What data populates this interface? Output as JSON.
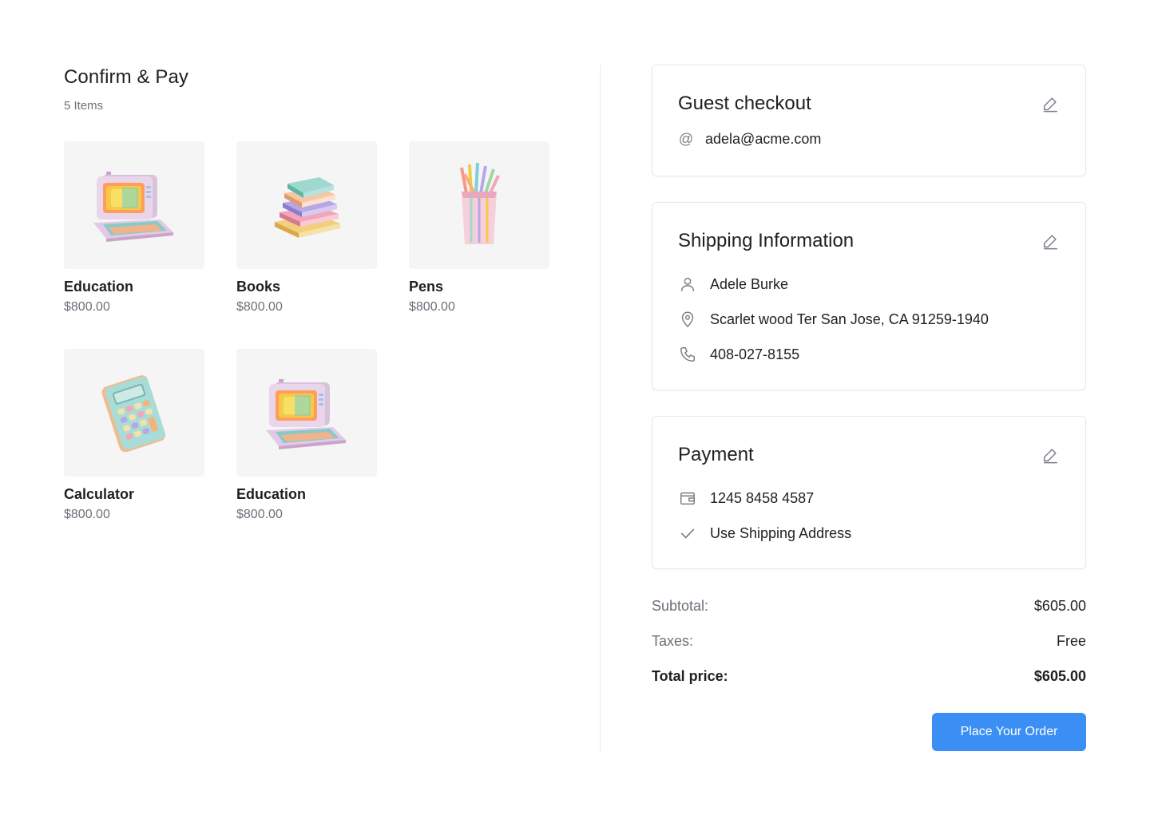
{
  "page": {
    "title": "Confirm & Pay",
    "item_count": "5 Items"
  },
  "products": [
    {
      "name": "Education",
      "price": "$800.00",
      "icon": "computer-illustration"
    },
    {
      "name": "Books",
      "price": "$800.00",
      "icon": "books-illustration"
    },
    {
      "name": "Pens",
      "price": "$800.00",
      "icon": "pencils-illustration"
    },
    {
      "name": "Calculator",
      "price": "$800.00",
      "icon": "calculator-illustration"
    },
    {
      "name": "Education",
      "price": "$800.00",
      "icon": "computer-illustration"
    }
  ],
  "guest": {
    "title": "Guest checkout",
    "at_symbol": "@",
    "email": "adela@acme.com"
  },
  "shipping": {
    "title": "Shipping Information",
    "name": "Adele Burke",
    "address": "Scarlet wood Ter San Jose, CA 91259-1940",
    "phone": "408-027-8155"
  },
  "payment": {
    "title": "Payment",
    "card": "1245 8458 4587",
    "use_shipping": "Use Shipping Address"
  },
  "summary": {
    "subtotal_label": "Subtotal:",
    "subtotal_value": "$605.00",
    "taxes_label": "Taxes:",
    "taxes_value": "Free",
    "total_label": "Total price:",
    "total_value": "$605.00"
  },
  "actions": {
    "place_order": "Place Your Order"
  },
  "colors": {
    "accent": "#3b8ef3",
    "text": "#1f2023",
    "muted": "#6b7078"
  }
}
